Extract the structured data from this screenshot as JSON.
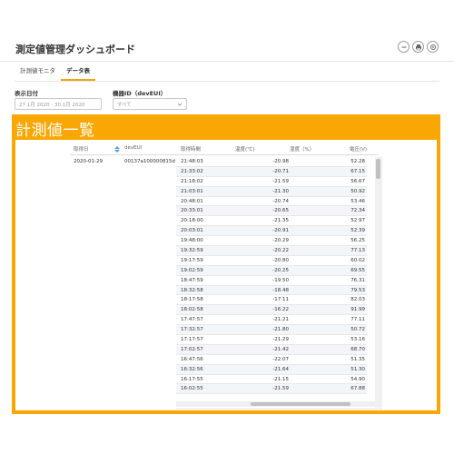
{
  "header": {
    "title": "測定値管理ダッシュボード"
  },
  "tabs": [
    {
      "label": "計測値モニタ"
    },
    {
      "label": "データ表"
    }
  ],
  "filters": {
    "date": {
      "label": "表示日付",
      "value": "27 1月 2020 - 30 1月 2020"
    },
    "device": {
      "label": "機器ID（devEUI）",
      "value": "すべて"
    }
  },
  "panel": {
    "title": "計測値一覧"
  },
  "table": {
    "headers": [
      "取得日",
      "devEUI",
      "取得時間",
      "温度(℃)",
      "湿度（%）",
      "電圧(V)"
    ],
    "first": {
      "date": "2020-01-29",
      "devEUI": "00137a100000815d"
    },
    "rows": [
      {
        "time": "21:48:03",
        "temp": "-20.98",
        "hum": "52.28"
      },
      {
        "time": "21:33:02",
        "temp": "-20.71",
        "hum": "67.15"
      },
      {
        "time": "21:18:02",
        "temp": "-21.59",
        "hum": "56.67"
      },
      {
        "time": "21:03:01",
        "temp": "-21.30",
        "hum": "50.92"
      },
      {
        "time": "20:48:01",
        "temp": "-20.74",
        "hum": "53.46"
      },
      {
        "time": "20:33:01",
        "temp": "-20.65",
        "hum": "72.34"
      },
      {
        "time": "20:18:00",
        "temp": "-21.35",
        "hum": "52.97"
      },
      {
        "time": "20:03:01",
        "temp": "-20.91",
        "hum": "52.39"
      },
      {
        "time": "19:48:00",
        "temp": "-20.29",
        "hum": "56.25"
      },
      {
        "time": "19:32:59",
        "temp": "-20.22",
        "hum": "77.13"
      },
      {
        "time": "19:17:59",
        "temp": "-20.80",
        "hum": "60.02"
      },
      {
        "time": "19:02:59",
        "temp": "-20.25",
        "hum": "69.55"
      },
      {
        "time": "18:47:59",
        "temp": "-19.50",
        "hum": "76.31"
      },
      {
        "time": "18:32:58",
        "temp": "-18.48",
        "hum": "79.53"
      },
      {
        "time": "18:17:58",
        "temp": "-17.11",
        "hum": "82.03"
      },
      {
        "time": "18:02:58",
        "temp": "-16.22",
        "hum": "91.99"
      },
      {
        "time": "17:47:57",
        "temp": "-21.21",
        "hum": "77.11"
      },
      {
        "time": "17:32:57",
        "temp": "-21.80",
        "hum": "50.72"
      },
      {
        "time": "17:17:57",
        "temp": "-21.29",
        "hum": "53.16"
      },
      {
        "time": "17:02:57",
        "temp": "-21.42",
        "hum": "68.70"
      },
      {
        "time": "16:47:56",
        "temp": "-22.07",
        "hum": "51.35"
      },
      {
        "time": "16:32:56",
        "temp": "-21.64",
        "hum": "51.30"
      },
      {
        "time": "16:17:55",
        "temp": "-21.15",
        "hum": "54.90"
      },
      {
        "time": "16:02:55",
        "temp": "-21.59",
        "hum": "67.88"
      }
    ]
  },
  "colors": {
    "accent": "#f9a704",
    "panel_text": "#ffffff"
  },
  "icons": [
    "minus-circle-icon",
    "print-icon",
    "settings-icon",
    "sort-icon",
    "chevron-down-icon"
  ]
}
